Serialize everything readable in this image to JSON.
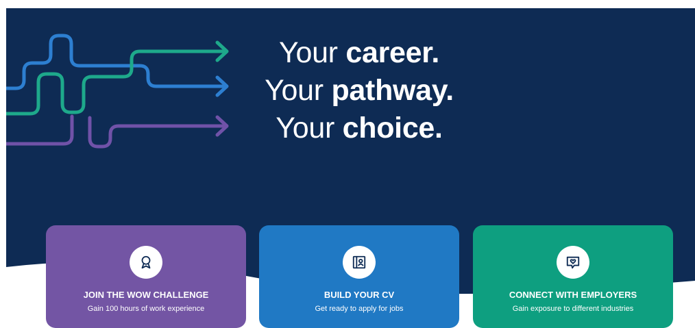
{
  "hero": {
    "lines": [
      {
        "prefix": "Your ",
        "emphasis": "career."
      },
      {
        "prefix": "Your ",
        "emphasis": "pathway."
      },
      {
        "prefix": "Your ",
        "emphasis": "choice."
      }
    ],
    "colors": {
      "background": "#0e2b54",
      "line_blue": "#2d7fd1",
      "line_green": "#1ea98b",
      "line_purple": "#7052a8"
    }
  },
  "cards": [
    {
      "title": "JOIN THE WOW CHALLENGE",
      "subtitle": "Gain 100 hours of work experience",
      "icon": "award-ribbon-icon",
      "color": "#7355a4"
    },
    {
      "title": "BUILD YOUR CV",
      "subtitle": "Get ready to apply for jobs",
      "icon": "cv-profile-icon",
      "color": "#2079c4"
    },
    {
      "title": "CONNECT WITH EMPLOYERS",
      "subtitle": "Gain exposure to different industries",
      "icon": "heart-chat-icon",
      "color": "#0e9f80"
    }
  ]
}
